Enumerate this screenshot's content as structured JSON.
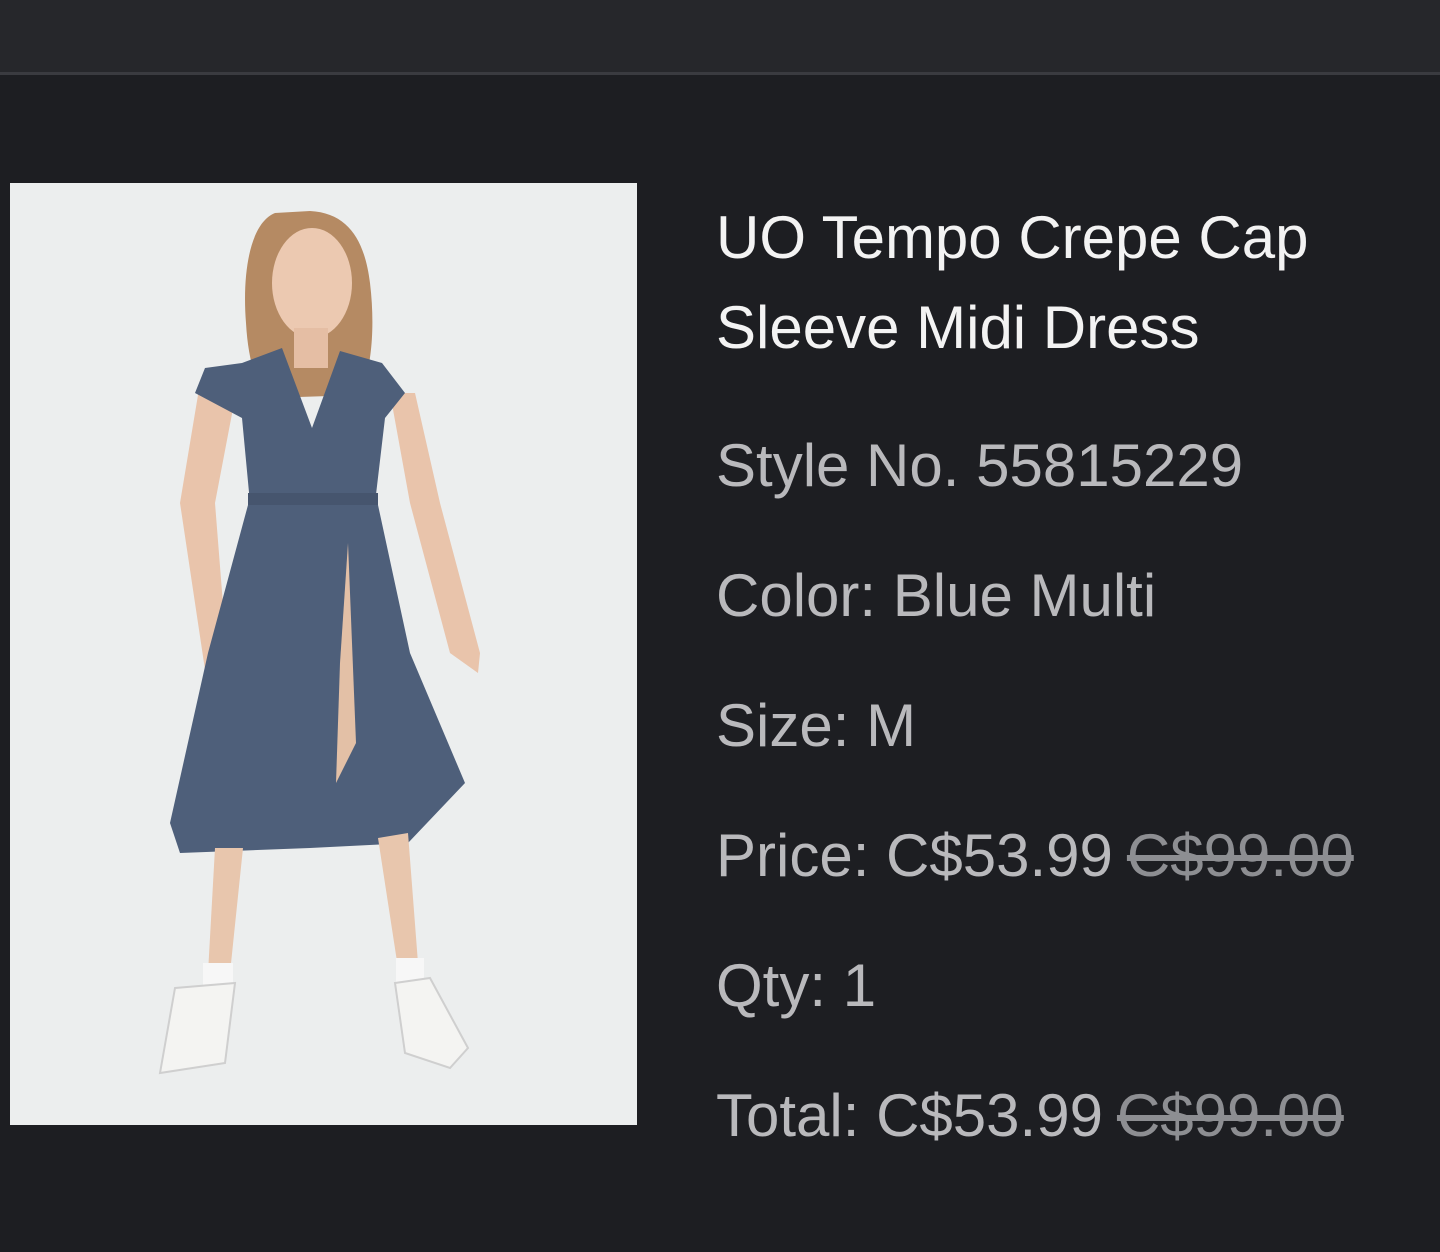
{
  "product": {
    "title": "UO Tempo Crepe Cap Sleeve Midi Dress",
    "style_label": "Style No.",
    "style_no": "55815229",
    "color_label": "Color:",
    "color": "Blue Multi",
    "size_label": "Size:",
    "size": "M",
    "price_label": "Price:",
    "price": "C$53.99",
    "price_original": "C$99.00",
    "qty_label": "Qty:",
    "qty": "1",
    "total_label": "Total:",
    "total": "C$53.99",
    "total_original": "C$99.00"
  },
  "colors": {
    "background": "#1d1e22",
    "topbar": "#26272b",
    "title_text": "#f3f3f3",
    "detail_text": "#b9b9bc",
    "dress": "#4e5f7a"
  }
}
